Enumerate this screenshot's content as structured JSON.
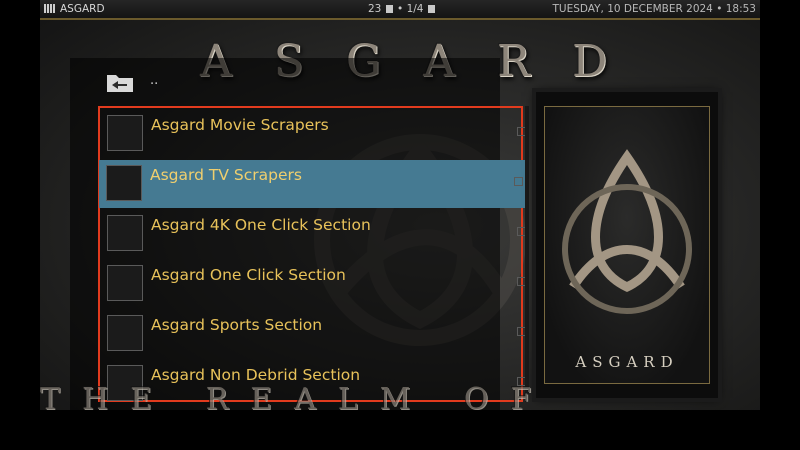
{
  "topbar": {
    "app_name": "ASGARD",
    "count": "23",
    "page": "1/4",
    "datetime": "TUESDAY, 10 DECEMBER 2024 • 18:53"
  },
  "background": {
    "title": "ASGARD",
    "tagline": "THE REALM OF STREAMING"
  },
  "list": {
    "parent_label": "..",
    "items": [
      {
        "label": "Asgard Movie Scrapers",
        "selected": false
      },
      {
        "label": "Asgard TV Scrapers",
        "selected": true
      },
      {
        "label": "Asgard 4K One Click Section",
        "selected": false
      },
      {
        "label": "Asgard One Click Section",
        "selected": false
      },
      {
        "label": "Asgard Sports Section",
        "selected": false
      },
      {
        "label": "Asgard Non Debrid Section",
        "selected": false
      }
    ]
  },
  "poster": {
    "title": "ASGARD"
  },
  "colors": {
    "accent_label": "#e8c25a",
    "selection": "#457a92",
    "frame": "#e23b1e"
  },
  "icons": {
    "parent": "folder-back-icon",
    "thumb": "triquetra-icon"
  }
}
